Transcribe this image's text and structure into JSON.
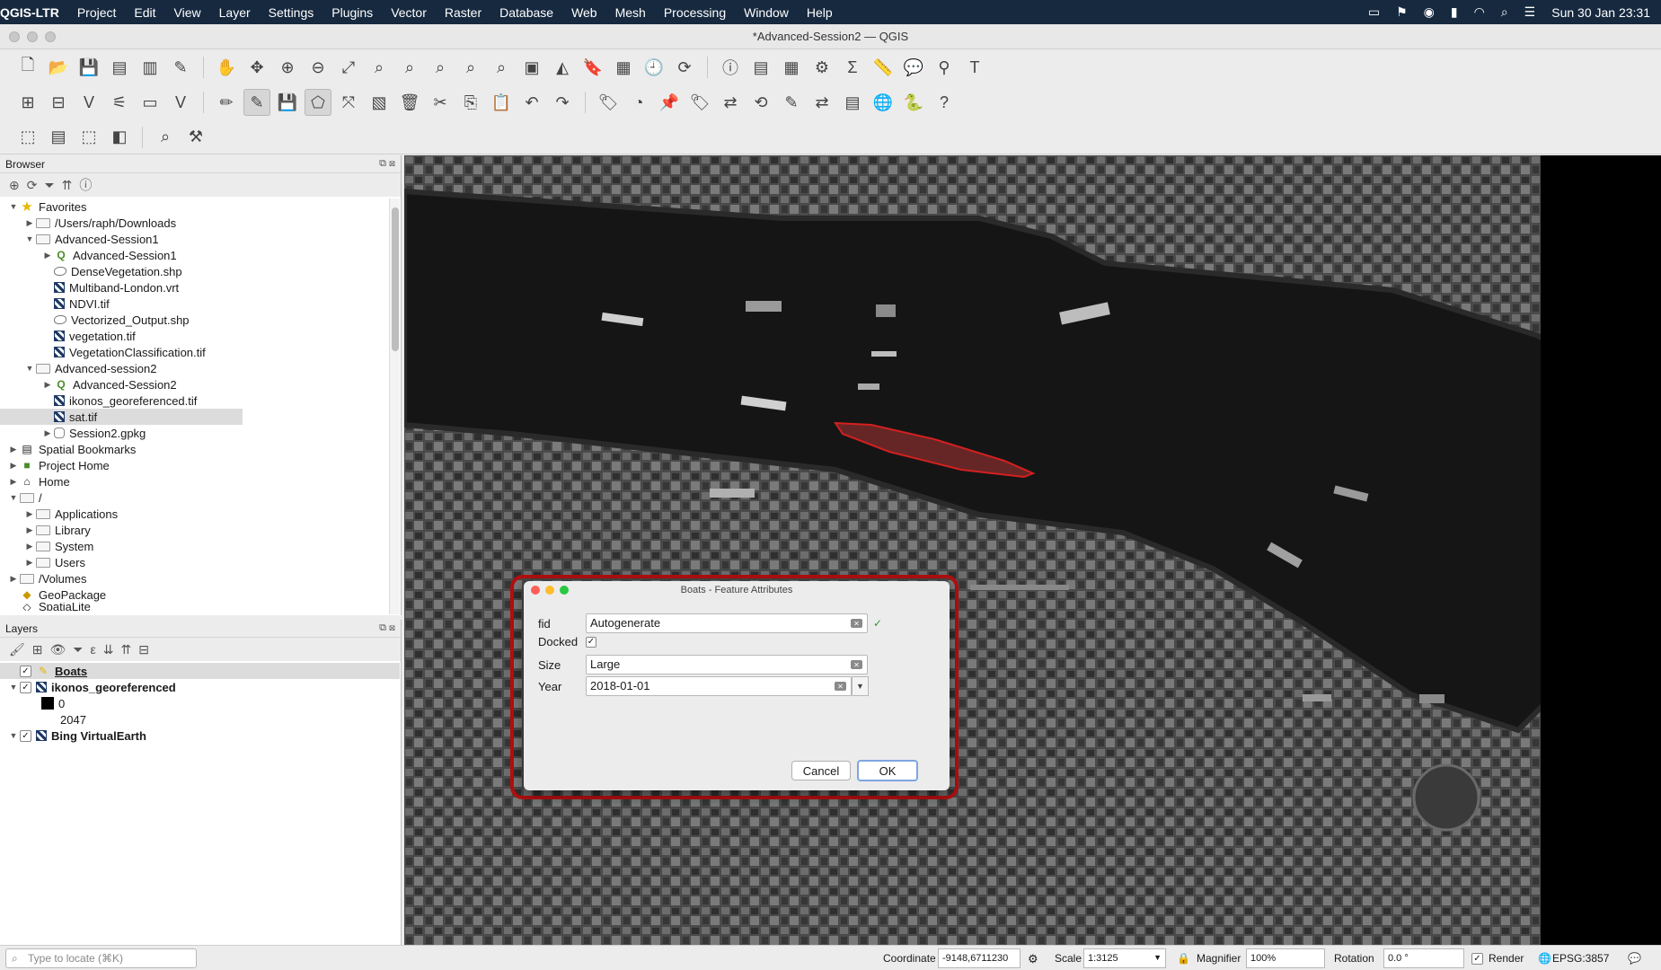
{
  "menubar": {
    "app_name": "QGIS-LTR",
    "items": [
      "Project",
      "Edit",
      "View",
      "Layer",
      "Settings",
      "Plugins",
      "Vector",
      "Raster",
      "Database",
      "Web",
      "Mesh",
      "Processing",
      "Window",
      "Help"
    ],
    "clock": "Sun 30 Jan  23:31"
  },
  "window": {
    "title": "*Advanced-Session2 — QGIS"
  },
  "browser": {
    "title": "Browser",
    "items": [
      {
        "label": "Favorites",
        "icon": "star-icon"
      },
      {
        "label": "/Users/raph/Downloads",
        "icon": "folder-icon"
      },
      {
        "label": "Advanced-Session1",
        "icon": "folder-icon"
      },
      {
        "label": "Advanced-Session1",
        "icon": "qgis-project-icon"
      },
      {
        "label": "DenseVegetation.shp",
        "icon": "vector-icon"
      },
      {
        "label": "Multiband-London.vrt",
        "icon": "raster-icon"
      },
      {
        "label": "NDVI.tif",
        "icon": "raster-icon"
      },
      {
        "label": "Vectorized_Output.shp",
        "icon": "vector-icon"
      },
      {
        "label": "vegetation.tif",
        "icon": "raster-icon"
      },
      {
        "label": "VegetationClassification.tif",
        "icon": "raster-icon"
      },
      {
        "label": "Advanced-session2",
        "icon": "folder-icon"
      },
      {
        "label": "Advanced-Session2",
        "icon": "qgis-project-icon"
      },
      {
        "label": "ikonos_georeferenced.tif",
        "icon": "raster-icon"
      },
      {
        "label": "sat.tif",
        "icon": "raster-icon"
      },
      {
        "label": "Session2.gpkg",
        "icon": "database-icon"
      },
      {
        "label": "Spatial Bookmarks",
        "icon": "bookmark-icon"
      },
      {
        "label": "Project Home",
        "icon": "project-home-icon"
      },
      {
        "label": "Home",
        "icon": "home-icon"
      },
      {
        "label": "/",
        "icon": "folder-icon"
      },
      {
        "label": "Applications",
        "icon": "folder-icon"
      },
      {
        "label": "Library",
        "icon": "folder-icon"
      },
      {
        "label": "System",
        "icon": "folder-icon"
      },
      {
        "label": "Users",
        "icon": "folder-icon"
      },
      {
        "label": "/Volumes",
        "icon": "folder-icon"
      },
      {
        "label": "GeoPackage",
        "icon": "geopackage-icon"
      },
      {
        "label": "SpatiaLite",
        "icon": "spatialite-icon"
      }
    ]
  },
  "layers": {
    "title": "Layers",
    "items": [
      {
        "label": "Boats",
        "checked": true
      },
      {
        "label": "ikonos_georeferenced",
        "checked": true
      },
      {
        "label": "0"
      },
      {
        "label": "2047"
      },
      {
        "label": "Bing VirtualEarth",
        "checked": true
      }
    ]
  },
  "dialog": {
    "title": "Boats - Feature Attributes",
    "fields": {
      "fid_label": "fid",
      "fid_value": "Autogenerate",
      "docked_label": "Docked",
      "docked_checked": true,
      "size_label": "Size",
      "size_value": "Large",
      "year_label": "Year",
      "year_value": "2018-01-01"
    },
    "cancel_label": "Cancel",
    "ok_label": "OK",
    "highlight_color": "#b40f0f"
  },
  "statusbar": {
    "locator_placeholder": "Type to locate (⌘K)",
    "coordinate_label": "Coordinate",
    "coordinate_value": "-9148,6711230",
    "scale_label": "Scale",
    "scale_value": "1:3125",
    "magnifier_label": "Magnifier",
    "magnifier_value": "100%",
    "rotation_label": "Rotation",
    "rotation_value": "0.0 °",
    "render_label": "Render",
    "crs_label": "EPSG:3857"
  }
}
